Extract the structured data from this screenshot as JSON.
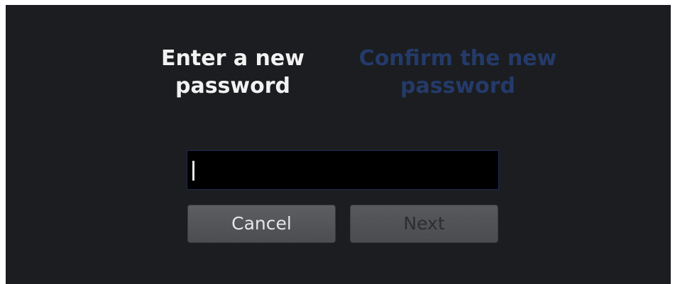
{
  "dialog": {
    "steps": [
      {
        "label": "Enter a new password",
        "line1": "Enter a new",
        "line2": "password",
        "state": "active"
      },
      {
        "label": "Confirm the new password",
        "line1": "Confirm the new",
        "line2": "password",
        "state": "inactive"
      }
    ],
    "password_field": {
      "value": "",
      "placeholder": ""
    },
    "buttons": {
      "cancel_label": "Cancel",
      "next_label": "Next"
    }
  },
  "colors": {
    "background": "#1b1d20",
    "active_step": "#f2f2f2",
    "inactive_step": "#243a6a",
    "button": "#55575a"
  }
}
